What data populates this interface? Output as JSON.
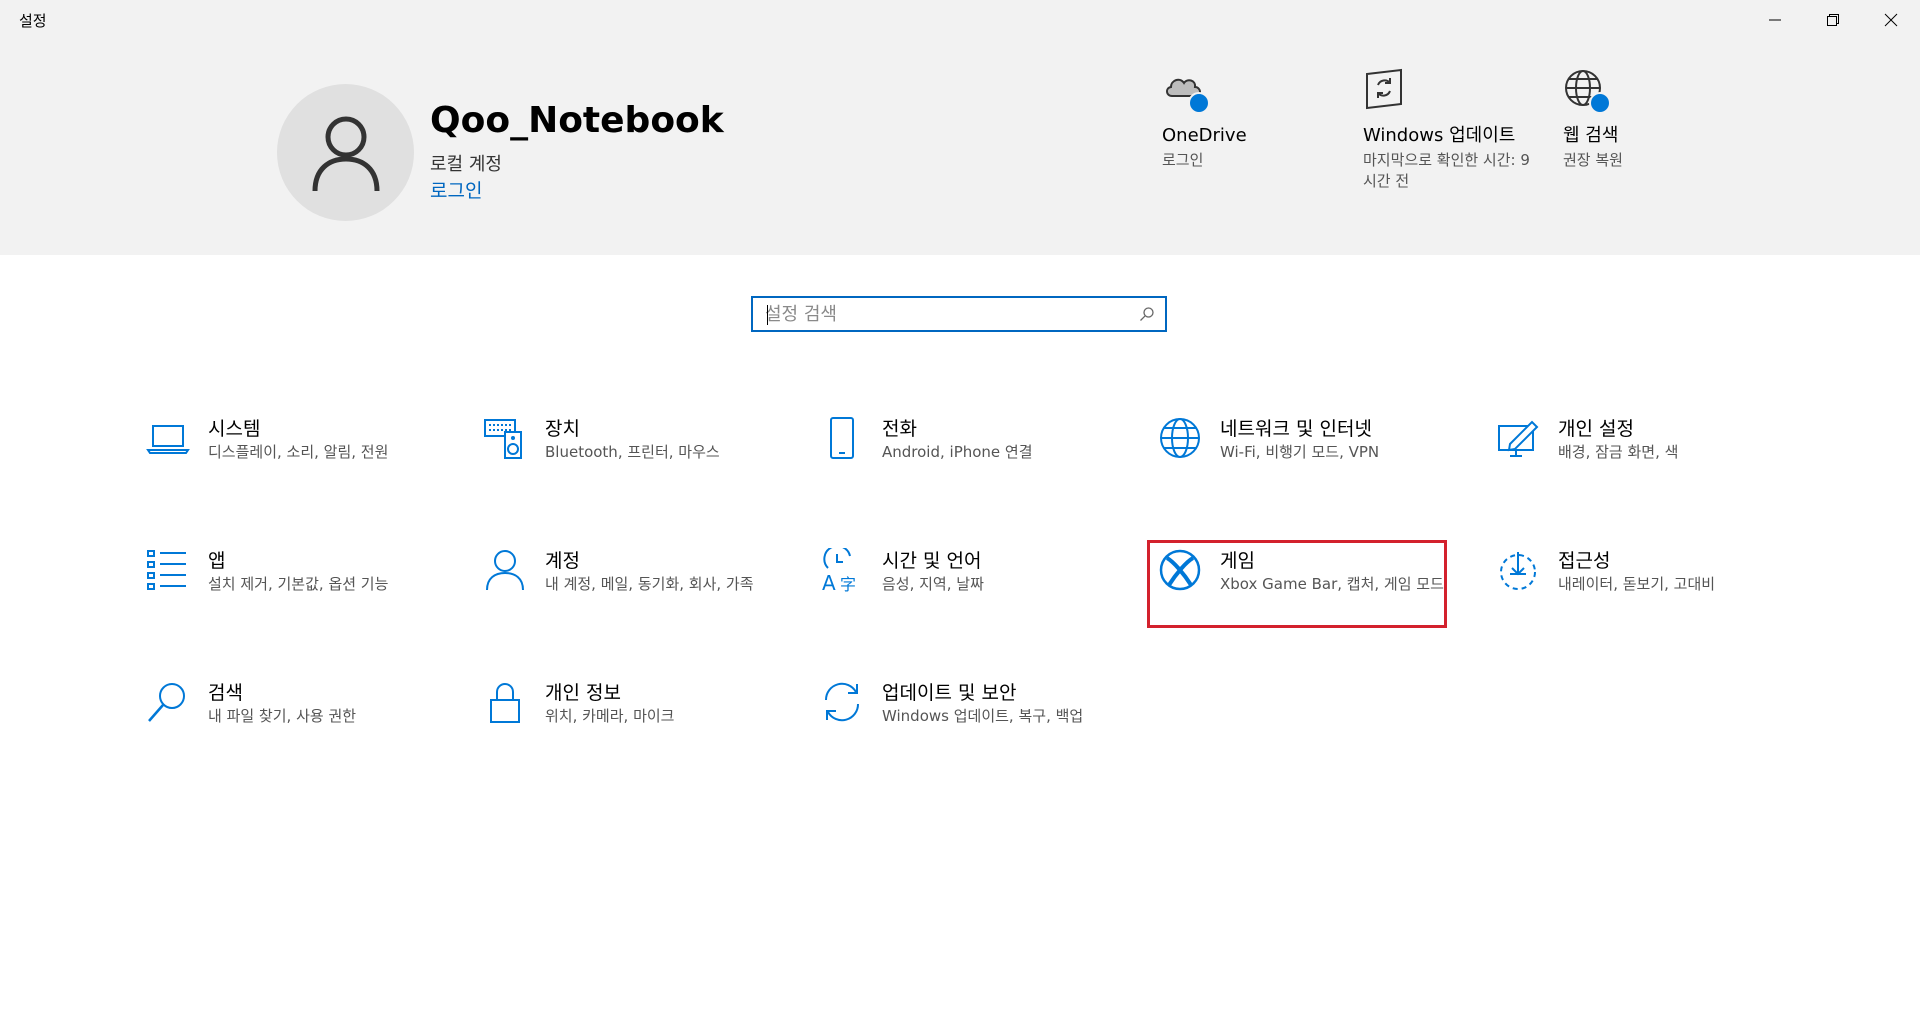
{
  "window": {
    "title": "설정",
    "controls": [
      "minimize-icon",
      "restore-icon",
      "close-icon"
    ]
  },
  "account": {
    "name": "Qoo_Notebook",
    "type": "로컬 계정",
    "login_link": "로그인"
  },
  "header_items": [
    {
      "title": "OneDrive",
      "subtitle": "로그인",
      "icon": "onedrive-icon"
    },
    {
      "title": "Windows 업데이트",
      "subtitle": "마지막으로 확인한 시간: 9시간 전",
      "icon": "windows-update-icon"
    },
    {
      "title": "웹 검색",
      "subtitle": "권장 복원",
      "icon": "globe-icon"
    }
  ],
  "search": {
    "placeholder": "설정 검색"
  },
  "categories": [
    {
      "title": "시스템",
      "subtitle": "디스플레이, 소리, 알림, 전원",
      "icon": "laptop-icon"
    },
    {
      "title": "장치",
      "subtitle": "Bluetooth, 프린터, 마우스",
      "icon": "keyboard-speaker-icon"
    },
    {
      "title": "전화",
      "subtitle": "Android, iPhone 연결",
      "icon": "phone-icon"
    },
    {
      "title": "네트워크 및 인터넷",
      "subtitle": "Wi-Fi, 비행기 모드, VPN",
      "icon": "globe-icon"
    },
    {
      "title": "개인 설정",
      "subtitle": "배경, 잠금 화면, 색",
      "icon": "personalization-icon"
    },
    {
      "title": "앱",
      "subtitle": "설치 제거, 기본값, 옵션 기능",
      "icon": "apps-list-icon"
    },
    {
      "title": "계정",
      "subtitle": "내 계정, 메일, 동기화, 회사, 가족",
      "icon": "person-icon"
    },
    {
      "title": "시간 및 언어",
      "subtitle": "음성, 지역, 날짜",
      "icon": "time-language-icon"
    },
    {
      "title": "게임",
      "subtitle": "Xbox Game Bar, 캡처, 게임 모드",
      "icon": "xbox-icon"
    },
    {
      "title": "접근성",
      "subtitle": "내레이터, 돋보기, 고대비",
      "icon": "ease-of-access-icon"
    },
    {
      "title": "검색",
      "subtitle": "내 파일 찾기, 사용 권한",
      "icon": "search-icon"
    },
    {
      "title": "개인 정보",
      "subtitle": "위치, 카메라, 마이크",
      "icon": "lock-icon"
    },
    {
      "title": "업데이트 및 보안",
      "subtitle": "Windows 업데이트, 복구, 백업",
      "icon": "sync-icon"
    }
  ],
  "colors": {
    "accent": "#0067c0",
    "icon_blue": "#0078d7",
    "header_bg": "#f2f2f2",
    "highlight": "#d3212d"
  }
}
